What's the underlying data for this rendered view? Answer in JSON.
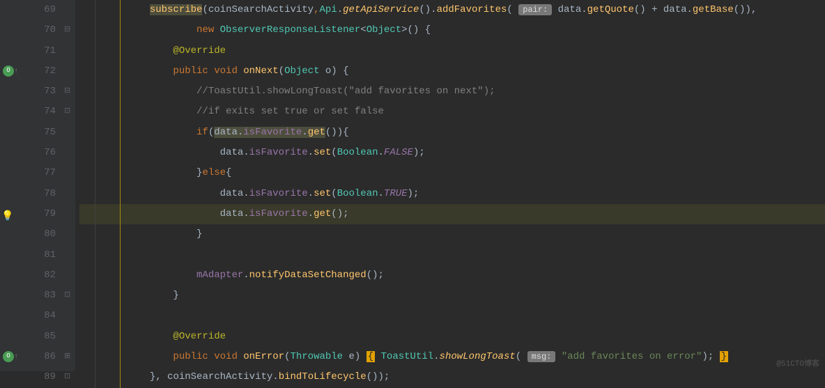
{
  "line_numbers": [
    "69",
    "70",
    "71",
    "72",
    "73",
    "74",
    "75",
    "76",
    "77",
    "78",
    "79",
    "80",
    "81",
    "82",
    "83",
    "84",
    "85",
    "86",
    "89"
  ],
  "gutter_badges": {
    "72": {
      "type": "green",
      "text": "O",
      "arrow": "↑"
    },
    "86": {
      "type": "green",
      "text": "O",
      "arrow": "↑"
    }
  },
  "fold_markers": {
    "70": "⊟",
    "73": "⊟",
    "74": "⊡",
    "83": "⊡",
    "86": "⊞",
    "89": "⊡"
  },
  "hints": {
    "79": "bulb"
  },
  "current_line": 79,
  "code": {
    "69": {
      "indent": "            ",
      "tokens": [
        {
          "t": "subscribe",
          "cls": "method sel-bg"
        },
        {
          "t": "(",
          "cls": "paren"
        },
        {
          "t": "coinSearchActivity",
          "cls": "ident"
        },
        {
          "t": ",",
          "cls": "kw"
        },
        {
          "t": "Api",
          "cls": "type"
        },
        {
          "t": ".",
          "cls": "paren"
        },
        {
          "t": "getApiService",
          "cls": "method-italic"
        },
        {
          "t": "()",
          "cls": "paren"
        },
        {
          "t": ".",
          "cls": "paren"
        },
        {
          "t": "addFavorites",
          "cls": "method"
        },
        {
          "t": "( ",
          "cls": "paren"
        },
        {
          "t": "pair:",
          "cls": "hint-param"
        },
        {
          "t": " ",
          "cls": "paren"
        },
        {
          "t": "data",
          "cls": "ident"
        },
        {
          "t": ".",
          "cls": "paren"
        },
        {
          "t": "getQuote",
          "cls": "method"
        },
        {
          "t": "()",
          "cls": "paren"
        },
        {
          "t": " + ",
          "cls": "paren"
        },
        {
          "t": "data",
          "cls": "ident"
        },
        {
          "t": ".",
          "cls": "paren"
        },
        {
          "t": "getBase",
          "cls": "method"
        },
        {
          "t": "()),",
          "cls": "paren"
        }
      ]
    },
    "70": {
      "indent": "                    ",
      "tokens": [
        {
          "t": "new ",
          "cls": "kw"
        },
        {
          "t": "ObserverResponseListener",
          "cls": "type"
        },
        {
          "t": "<",
          "cls": "paren"
        },
        {
          "t": "Object",
          "cls": "type"
        },
        {
          "t": ">() {",
          "cls": "paren"
        }
      ]
    },
    "71": {
      "indent": "                ",
      "tokens": [
        {
          "t": "@Override",
          "cls": "annotation"
        }
      ]
    },
    "72": {
      "indent": "                ",
      "tokens": [
        {
          "t": "public ",
          "cls": "kw"
        },
        {
          "t": "void ",
          "cls": "kw"
        },
        {
          "t": "onNext",
          "cls": "method"
        },
        {
          "t": "(",
          "cls": "paren"
        },
        {
          "t": "Object",
          "cls": "type"
        },
        {
          "t": " o) {",
          "cls": "paren"
        }
      ]
    },
    "73": {
      "indent": "                    ",
      "tokens": [
        {
          "t": "//ToastUtil.showLongToast(\"add favorites on next\");",
          "cls": "comment"
        }
      ]
    },
    "74": {
      "indent": "                    ",
      "tokens": [
        {
          "t": "//if exits set true or set false",
          "cls": "comment"
        }
      ]
    },
    "75": {
      "indent": "                    ",
      "tokens": [
        {
          "t": "if",
          "cls": "kw"
        },
        {
          "t": "(",
          "cls": "paren"
        },
        {
          "t": "data",
          "cls": "ident sel-bg"
        },
        {
          "t": ".",
          "cls": "paren sel-bg"
        },
        {
          "t": "isFavorite",
          "cls": "field sel-bg"
        },
        {
          "t": ".",
          "cls": "paren sel-bg"
        },
        {
          "t": "get",
          "cls": "method sel-bg"
        },
        {
          "t": "()){",
          "cls": "paren"
        }
      ]
    },
    "76": {
      "indent": "                        ",
      "tokens": [
        {
          "t": "data",
          "cls": "ident"
        },
        {
          "t": ".",
          "cls": "paren"
        },
        {
          "t": "isFavorite",
          "cls": "field"
        },
        {
          "t": ".",
          "cls": "paren"
        },
        {
          "t": "set",
          "cls": "method"
        },
        {
          "t": "(",
          "cls": "paren"
        },
        {
          "t": "Boolean",
          "cls": "type"
        },
        {
          "t": ".",
          "cls": "paren"
        },
        {
          "t": "FALSE",
          "cls": "const-italic"
        },
        {
          "t": ");",
          "cls": "paren"
        }
      ]
    },
    "77": {
      "indent": "                    ",
      "tokens": [
        {
          "t": "}",
          "cls": "paren"
        },
        {
          "t": "else",
          "cls": "kw"
        },
        {
          "t": "{",
          "cls": "paren"
        }
      ]
    },
    "78": {
      "indent": "                        ",
      "tokens": [
        {
          "t": "data",
          "cls": "ident"
        },
        {
          "t": ".",
          "cls": "paren"
        },
        {
          "t": "isFavorite",
          "cls": "field"
        },
        {
          "t": ".",
          "cls": "paren"
        },
        {
          "t": "set",
          "cls": "method"
        },
        {
          "t": "(",
          "cls": "paren"
        },
        {
          "t": "Boolean",
          "cls": "type"
        },
        {
          "t": ".",
          "cls": "paren"
        },
        {
          "t": "TRUE",
          "cls": "const-italic"
        },
        {
          "t": ");",
          "cls": "paren"
        }
      ]
    },
    "79": {
      "indent": "                        ",
      "tokens": [
        {
          "t": "data",
          "cls": "ident"
        },
        {
          "t": ".",
          "cls": "paren"
        },
        {
          "t": "isFavorite",
          "cls": "field"
        },
        {
          "t": ".",
          "cls": "paren"
        },
        {
          "t": "get",
          "cls": "method"
        },
        {
          "t": "();",
          "cls": "paren"
        }
      ]
    },
    "80": {
      "indent": "                    ",
      "tokens": [
        {
          "t": "}",
          "cls": "paren"
        }
      ]
    },
    "81": {
      "indent": "",
      "tokens": []
    },
    "82": {
      "indent": "                    ",
      "tokens": [
        {
          "t": "mAdapter",
          "cls": "field"
        },
        {
          "t": ".",
          "cls": "paren"
        },
        {
          "t": "notifyDataSetChanged",
          "cls": "method"
        },
        {
          "t": "();",
          "cls": "paren"
        }
      ]
    },
    "83": {
      "indent": "                ",
      "tokens": [
        {
          "t": "}",
          "cls": "paren"
        }
      ]
    },
    "84": {
      "indent": "",
      "tokens": []
    },
    "85": {
      "indent": "                ",
      "tokens": [
        {
          "t": "@Override",
          "cls": "annotation"
        }
      ]
    },
    "86": {
      "indent": "                ",
      "tokens": [
        {
          "t": "public ",
          "cls": "kw"
        },
        {
          "t": "void ",
          "cls": "kw"
        },
        {
          "t": "onError",
          "cls": "method"
        },
        {
          "t": "(",
          "cls": "paren"
        },
        {
          "t": "Throwable",
          "cls": "type"
        },
        {
          "t": " e) ",
          "cls": "paren"
        },
        {
          "t": "{",
          "cls": "brace-highlight"
        },
        {
          "t": " ",
          "cls": "paren"
        },
        {
          "t": "ToastUtil",
          "cls": "type"
        },
        {
          "t": ".",
          "cls": "paren"
        },
        {
          "t": "showLongToast",
          "cls": "method-italic"
        },
        {
          "t": "( ",
          "cls": "paren"
        },
        {
          "t": "msg:",
          "cls": "hint-param"
        },
        {
          "t": " ",
          "cls": "paren"
        },
        {
          "t": "\"add favorites on error\"",
          "cls": "string"
        },
        {
          "t": "); ",
          "cls": "paren"
        },
        {
          "t": "}",
          "cls": "brace-highlight"
        }
      ]
    },
    "89": {
      "indent": "            ",
      "tokens": [
        {
          "t": "}, ",
          "cls": "paren"
        },
        {
          "t": "coinSearchActivity",
          "cls": "ident"
        },
        {
          "t": ".",
          "cls": "paren"
        },
        {
          "t": "bindToLifecycle",
          "cls": "method"
        },
        {
          "t": "());",
          "cls": "paren"
        }
      ]
    }
  },
  "watermark": "@51CTO博客"
}
